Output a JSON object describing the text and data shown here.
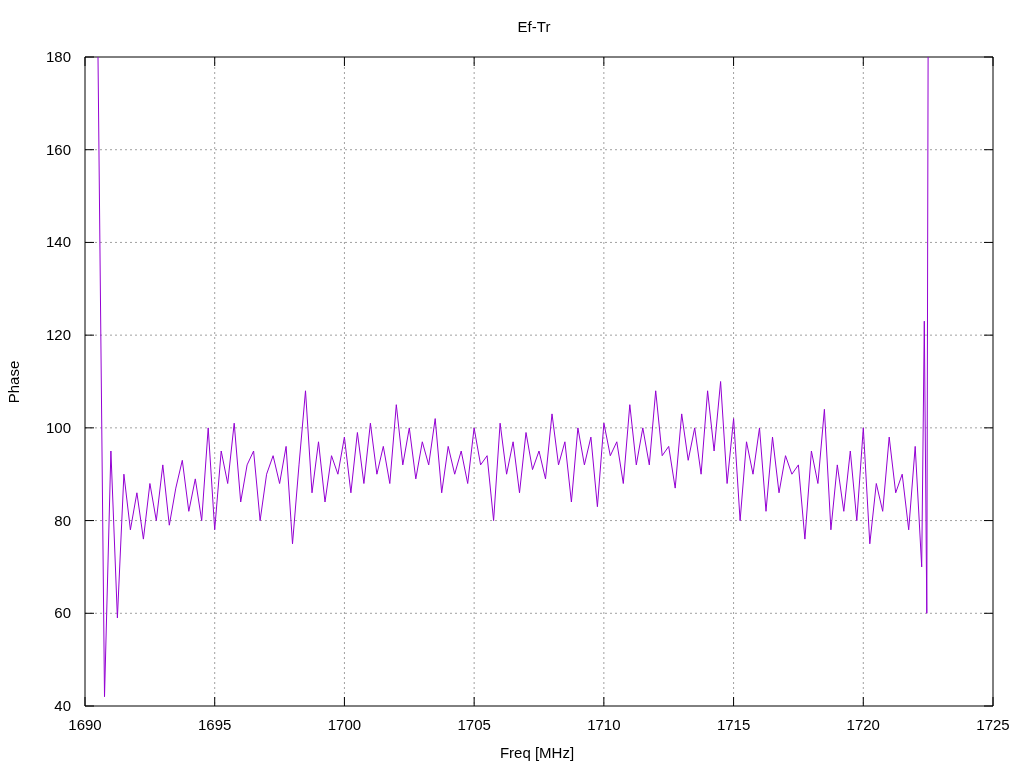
{
  "chart": {
    "chart_data": {
      "type": "line",
      "title": "Ef-Tr",
      "xlabel": "Freq [MHz]",
      "ylabel": "Phase",
      "grid": true,
      "xlim": [
        1690,
        1725
      ],
      "ylim": [
        40,
        180
      ],
      "xticks": [
        1690,
        1695,
        1700,
        1705,
        1710,
        1715,
        1720,
        1725
      ],
      "yticks": [
        40,
        60,
        80,
        100,
        120,
        140,
        160,
        180
      ],
      "x": [
        1690.5,
        1690.75,
        1691,
        1691.25,
        1691.5,
        1691.75,
        1692,
        1692.25,
        1692.5,
        1692.75,
        1693,
        1693.25,
        1693.5,
        1693.75,
        1694,
        1694.25,
        1694.5,
        1694.75,
        1695,
        1695.25,
        1695.5,
        1695.75,
        1696,
        1696.25,
        1696.5,
        1696.75,
        1697,
        1697.25,
        1697.5,
        1697.75,
        1698,
        1698.25,
        1698.5,
        1698.75,
        1699,
        1699.25,
        1699.5,
        1699.75,
        1700,
        1700.25,
        1700.5,
        1700.75,
        1701,
        1701.25,
        1701.5,
        1701.75,
        1702,
        1702.25,
        1702.5,
        1702.75,
        1703,
        1703.25,
        1703.5,
        1703.75,
        1704,
        1704.25,
        1704.5,
        1704.75,
        1705,
        1705.25,
        1705.5,
        1705.75,
        1706,
        1706.25,
        1706.5,
        1706.75,
        1707,
        1707.25,
        1707.5,
        1707.75,
        1708,
        1708.25,
        1708.5,
        1708.75,
        1709,
        1709.25,
        1709.5,
        1709.75,
        1710,
        1710.25,
        1710.5,
        1710.75,
        1711,
        1711.25,
        1711.5,
        1711.75,
        1712,
        1712.25,
        1712.5,
        1712.75,
        1713,
        1713.25,
        1713.5,
        1713.75,
        1714,
        1714.25,
        1714.5,
        1714.75,
        1715,
        1715.25,
        1715.5,
        1715.75,
        1716,
        1716.25,
        1716.5,
        1716.75,
        1717,
        1717.25,
        1717.5,
        1717.75,
        1718,
        1718.25,
        1718.5,
        1718.75,
        1719,
        1719.25,
        1719.5,
        1719.75,
        1720,
        1720.25,
        1720.5,
        1720.75,
        1721,
        1721.25,
        1721.5,
        1721.75,
        1722,
        1722.25,
        1722.35,
        1722.45,
        1722.5
      ],
      "series": [
        {
          "color": "#9400d3",
          "values": [
            180,
            42,
            95,
            59,
            90,
            78,
            86,
            76,
            88,
            80,
            92,
            79,
            87,
            93,
            82,
            89,
            80,
            100,
            78,
            95,
            88,
            101,
            84,
            92,
            95,
            80,
            90,
            94,
            88,
            96,
            75,
            92,
            108,
            86,
            97,
            84,
            94,
            90,
            98,
            86,
            99,
            88,
            101,
            90,
            96,
            88,
            105,
            92,
            100,
            89,
            97,
            92,
            102,
            86,
            96,
            90,
            95,
            88,
            100,
            92,
            94,
            80,
            101,
            90,
            97,
            86,
            99,
            91,
            95,
            89,
            103,
            92,
            97,
            84,
            100,
            92,
            98,
            83,
            101,
            94,
            97,
            88,
            105,
            92,
            100,
            92,
            108,
            94,
            96,
            87,
            103,
            93,
            100,
            90,
            108,
            95,
            110,
            88,
            102,
            80,
            97,
            90,
            100,
            82,
            98,
            86,
            94,
            90,
            92,
            76,
            95,
            88,
            104,
            78,
            92,
            82,
            95,
            80,
            100,
            75,
            88,
            82,
            98,
            86,
            90,
            78,
            96,
            70,
            123,
            60,
            180
          ]
        }
      ]
    }
  }
}
